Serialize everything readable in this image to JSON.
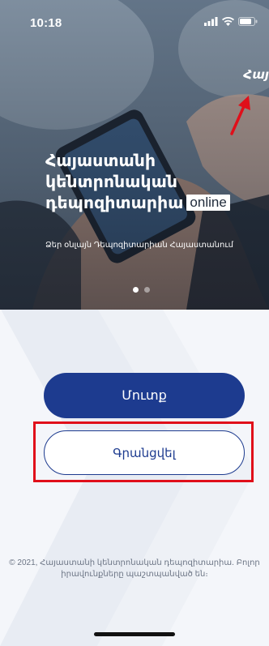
{
  "status_bar": {
    "time": "10:18",
    "icons": [
      "signal-icon",
      "wifi-icon",
      "battery-icon"
    ]
  },
  "hero": {
    "title_line1": "Հայաստանի",
    "title_line2": "կենտրոնական",
    "title_line3": "դեպոզիտարիա",
    "badge": "online",
    "subtitle": "Ձեր օնլայն Դեպոզիտարիան Հայաստանում",
    "corner_label": "Հայ",
    "carousel": {
      "total": 2,
      "active_index": 0
    }
  },
  "actions": {
    "login_label": "Մուտք",
    "register_label": "Գրանցվել"
  },
  "footer": {
    "line1": "© 2021, Հայաստանի կենտրոնական դեպոզիտարիա. Բոլոր",
    "line2": "իրավունքները պաշտպանված են։"
  },
  "colors": {
    "primary": "#1d3b8f",
    "highlight": "#e00f1a",
    "background": "#f4f6fa"
  }
}
